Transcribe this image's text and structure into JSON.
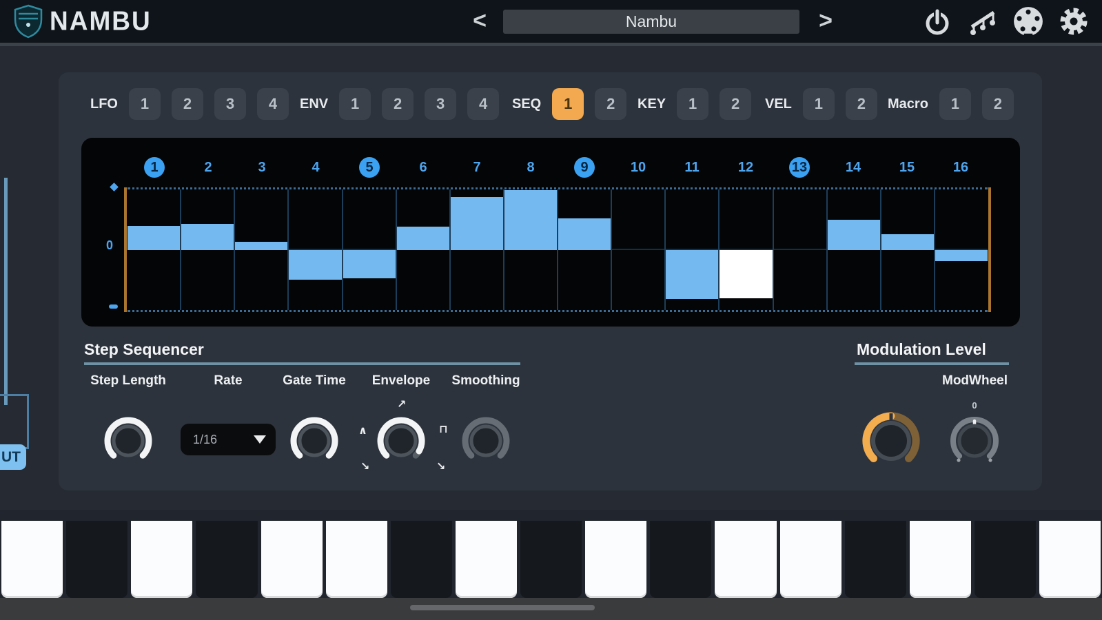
{
  "header": {
    "logo_text": "NAMBU",
    "prev_label": "<",
    "next_label": ">",
    "preset_name": "Nambu",
    "icons": [
      "power-icon",
      "arpeggio-notes-icon",
      "midi-din-icon",
      "gear-icon"
    ]
  },
  "tabs": {
    "groups": [
      {
        "label": "LFO",
        "buttons": [
          "1",
          "2",
          "3",
          "4"
        ],
        "active_index": -1
      },
      {
        "label": "ENV",
        "buttons": [
          "1",
          "2",
          "3",
          "4"
        ],
        "active_index": -1
      },
      {
        "label": "SEQ",
        "buttons": [
          "1",
          "2"
        ],
        "active_index": 0
      },
      {
        "label": "KEY",
        "buttons": [
          "1",
          "2"
        ],
        "active_index": -1
      },
      {
        "label": "VEL",
        "buttons": [
          "1",
          "2"
        ],
        "active_index": -1
      },
      {
        "label": "Macro",
        "buttons": [
          "1",
          "2"
        ],
        "active_index": -1
      }
    ]
  },
  "chart_data": {
    "type": "bar",
    "title": "Step sequencer pattern (SEQ 1)",
    "categories": [
      "1",
      "2",
      "3",
      "4",
      "5",
      "6",
      "7",
      "8",
      "9",
      "10",
      "11",
      "12",
      "13",
      "14",
      "15",
      "16"
    ],
    "values": [
      0.4,
      0.44,
      0.14,
      -0.49,
      -0.47,
      0.39,
      0.89,
      1.0,
      0.53,
      0.02,
      -0.82,
      -0.8,
      0.0,
      0.5,
      0.27,
      -0.18
    ],
    "ylim": [
      -1,
      1
    ],
    "zero_label": "0",
    "beat_steps": [
      1,
      5,
      9,
      13
    ],
    "playhead_step": 12,
    "bar_color": "#74baf1",
    "playhead_color": "#ffffff",
    "loop_marker_color": "#a9752f"
  },
  "step_sequencer": {
    "title": "Step Sequencer",
    "knobs": [
      {
        "label": "Step Length"
      },
      {
        "label": "Rate",
        "value": "1/16"
      },
      {
        "label": "Gate Time"
      },
      {
        "label": "Envelope"
      },
      {
        "label": "Smoothing"
      }
    ],
    "envelope_glyphs": {
      "left": "∧",
      "top": "↗",
      "right": "⊓",
      "bottom_right": "↘",
      "bottom_left": "↘"
    }
  },
  "modulation": {
    "title": "Modulation Level",
    "modwheel_label": "ModWheel",
    "modwheel_zero": "0"
  },
  "left_edge": {
    "badge": "UT"
  },
  "keyboard": {
    "keys": [
      "w",
      "b",
      "w",
      "b",
      "w",
      "w",
      "b",
      "w",
      "b",
      "w",
      "b",
      "w",
      "w",
      "b",
      "w",
      "b",
      "w"
    ]
  },
  "colors": {
    "accent_orange": "#f2a950",
    "accent_blue": "#4da5f0",
    "bar_blue": "#74baf1",
    "panel": "#2d333c",
    "background": "#262b33",
    "display_black": "#040507"
  }
}
